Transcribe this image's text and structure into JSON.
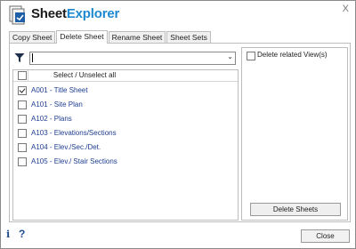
{
  "app": {
    "title_part1": "Sheet",
    "title_part2": "Explorer",
    "close_glyph": "X",
    "accent_color": "#1e88d0"
  },
  "tabs": [
    {
      "label": "Copy Sheet",
      "active": false
    },
    {
      "label": "Delete Sheet",
      "active": true
    },
    {
      "label": "Rename Sheet",
      "active": false
    },
    {
      "label": "Sheet Sets",
      "active": false
    }
  ],
  "filter": {
    "icon": "filter-icon",
    "value": "",
    "dropdown_icon": "chevron-down-icon"
  },
  "list": {
    "header_label": "Select / Unselect all",
    "header_checked": false,
    "items": [
      {
        "label": "A001 - Title Sheet",
        "checked": true
      },
      {
        "label": "A101 - Site Plan",
        "checked": false
      },
      {
        "label": "A102 - Plans",
        "checked": false
      },
      {
        "label": "A103 - Elevations/Sections",
        "checked": false
      },
      {
        "label": "A104 - Elev./Sec./Det.",
        "checked": false
      },
      {
        "label": "A105 - Elev./ Stair Sections",
        "checked": false
      }
    ]
  },
  "options": {
    "delete_related_label": "Delete related View(s)",
    "delete_related_checked": false,
    "delete_button_label": "Delete Sheets"
  },
  "footer": {
    "info_glyph": "i",
    "help_glyph": "?",
    "close_label": "Close"
  }
}
